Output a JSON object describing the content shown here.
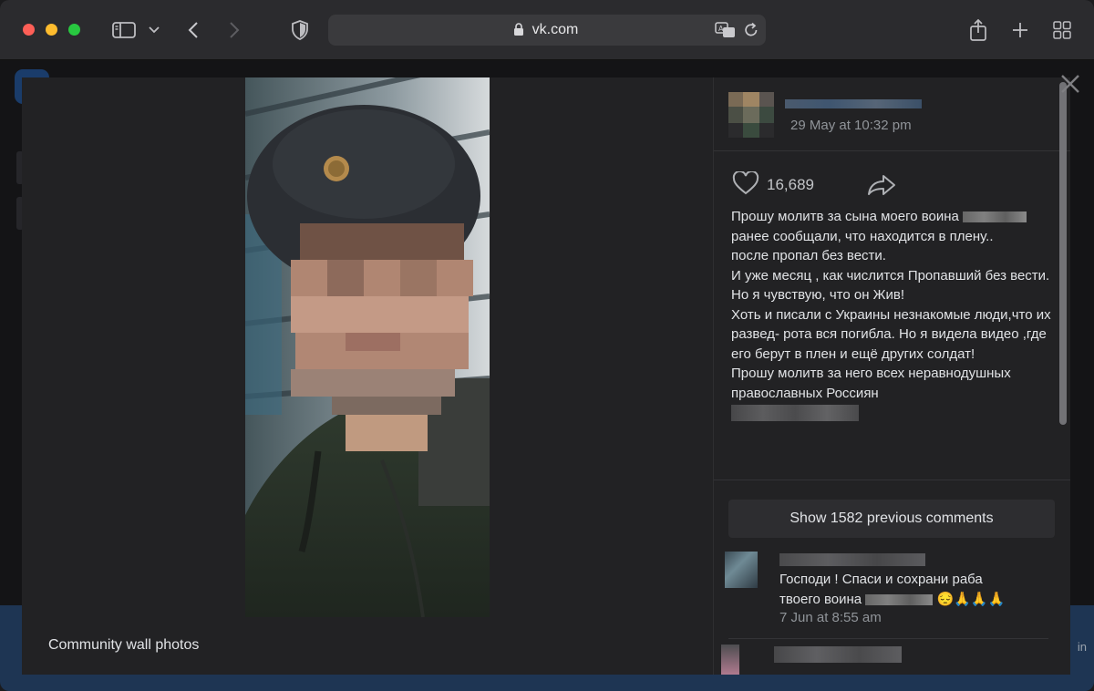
{
  "browser": {
    "url": "vk.com"
  },
  "background": {
    "signin_fragment": "in"
  },
  "viewer": {
    "album_caption": "Community wall photos",
    "post": {
      "date": "29 May at 10:32 pm",
      "likes": "16,689",
      "text_lines": [
        "Прошу молитв за сына моего воина ",
        "ранее сообщали, что находится в плену..",
        "после пропал без вести.",
        "И уже месяц , как числится Пропавший без вести.",
        "Но я чувствую, что он Жив!",
        "Хоть и писали с Украины незнакомые люди,что их развед- рота вся погибла. Но я видела видео ,где его берут в плен и ещё других солдат!",
        "Прошу молитв за него всех неравнодушных православных Россиян"
      ]
    },
    "show_comments_label": "Show 1582 previous comments",
    "comment": {
      "text_line1": "Господи ! Спаси и сохрани раба",
      "text_line2": "твоего воина ",
      "emojis": "😔🙏🙏🙏",
      "time": "7 Jun at 8:55 am"
    }
  }
}
